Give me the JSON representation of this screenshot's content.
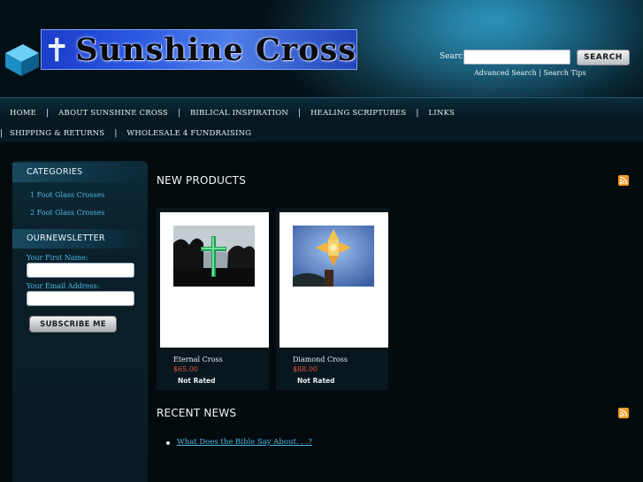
{
  "header": {
    "logo_text": "Sunshine Cross",
    "search_label": "Search",
    "search_placeholder": "",
    "search_button": "SEARCH",
    "advanced_search": "Advanced Search",
    "search_tips": "Search Tips",
    "link_separator": "|"
  },
  "nav": {
    "row1": [
      "HOME",
      "ABOUT SUNSHINE CROSS",
      "BIBLICAL INSPIRATION",
      "HEALING SCRIPTURES",
      "LINKS"
    ],
    "row2": [
      "SHIPPING & RETURNS",
      "WHOLESALE 4 FUNDRAISING"
    ],
    "separator": "|"
  },
  "sidebar": {
    "categories_heading": "CATEGORIES",
    "categories": [
      "1 Foot Glass Crosses",
      "2 Foot Glass Crosses"
    ],
    "newsletter_heading": "OURNEWSLETTER",
    "first_name_label": "Your First Name:",
    "email_label": "Your Email Address:",
    "subscribe_button": "SUBSCRIBE ME"
  },
  "main": {
    "new_products_title": "NEW PRODUCTS",
    "products": [
      {
        "name": "Eternal Cross",
        "price": "$65.00",
        "rating": "Not Rated"
      },
      {
        "name": "Diamond Cross",
        "price": "$88.00",
        "rating": "Not Rated"
      }
    ],
    "recent_news_title": "RECENT NEWS",
    "news": [
      "What Does the Bible Say About. . .?"
    ]
  },
  "colors": {
    "link": "#4fb9e6",
    "price": "#e5543b",
    "rss": "#f39a27",
    "background": "#040b0f"
  }
}
